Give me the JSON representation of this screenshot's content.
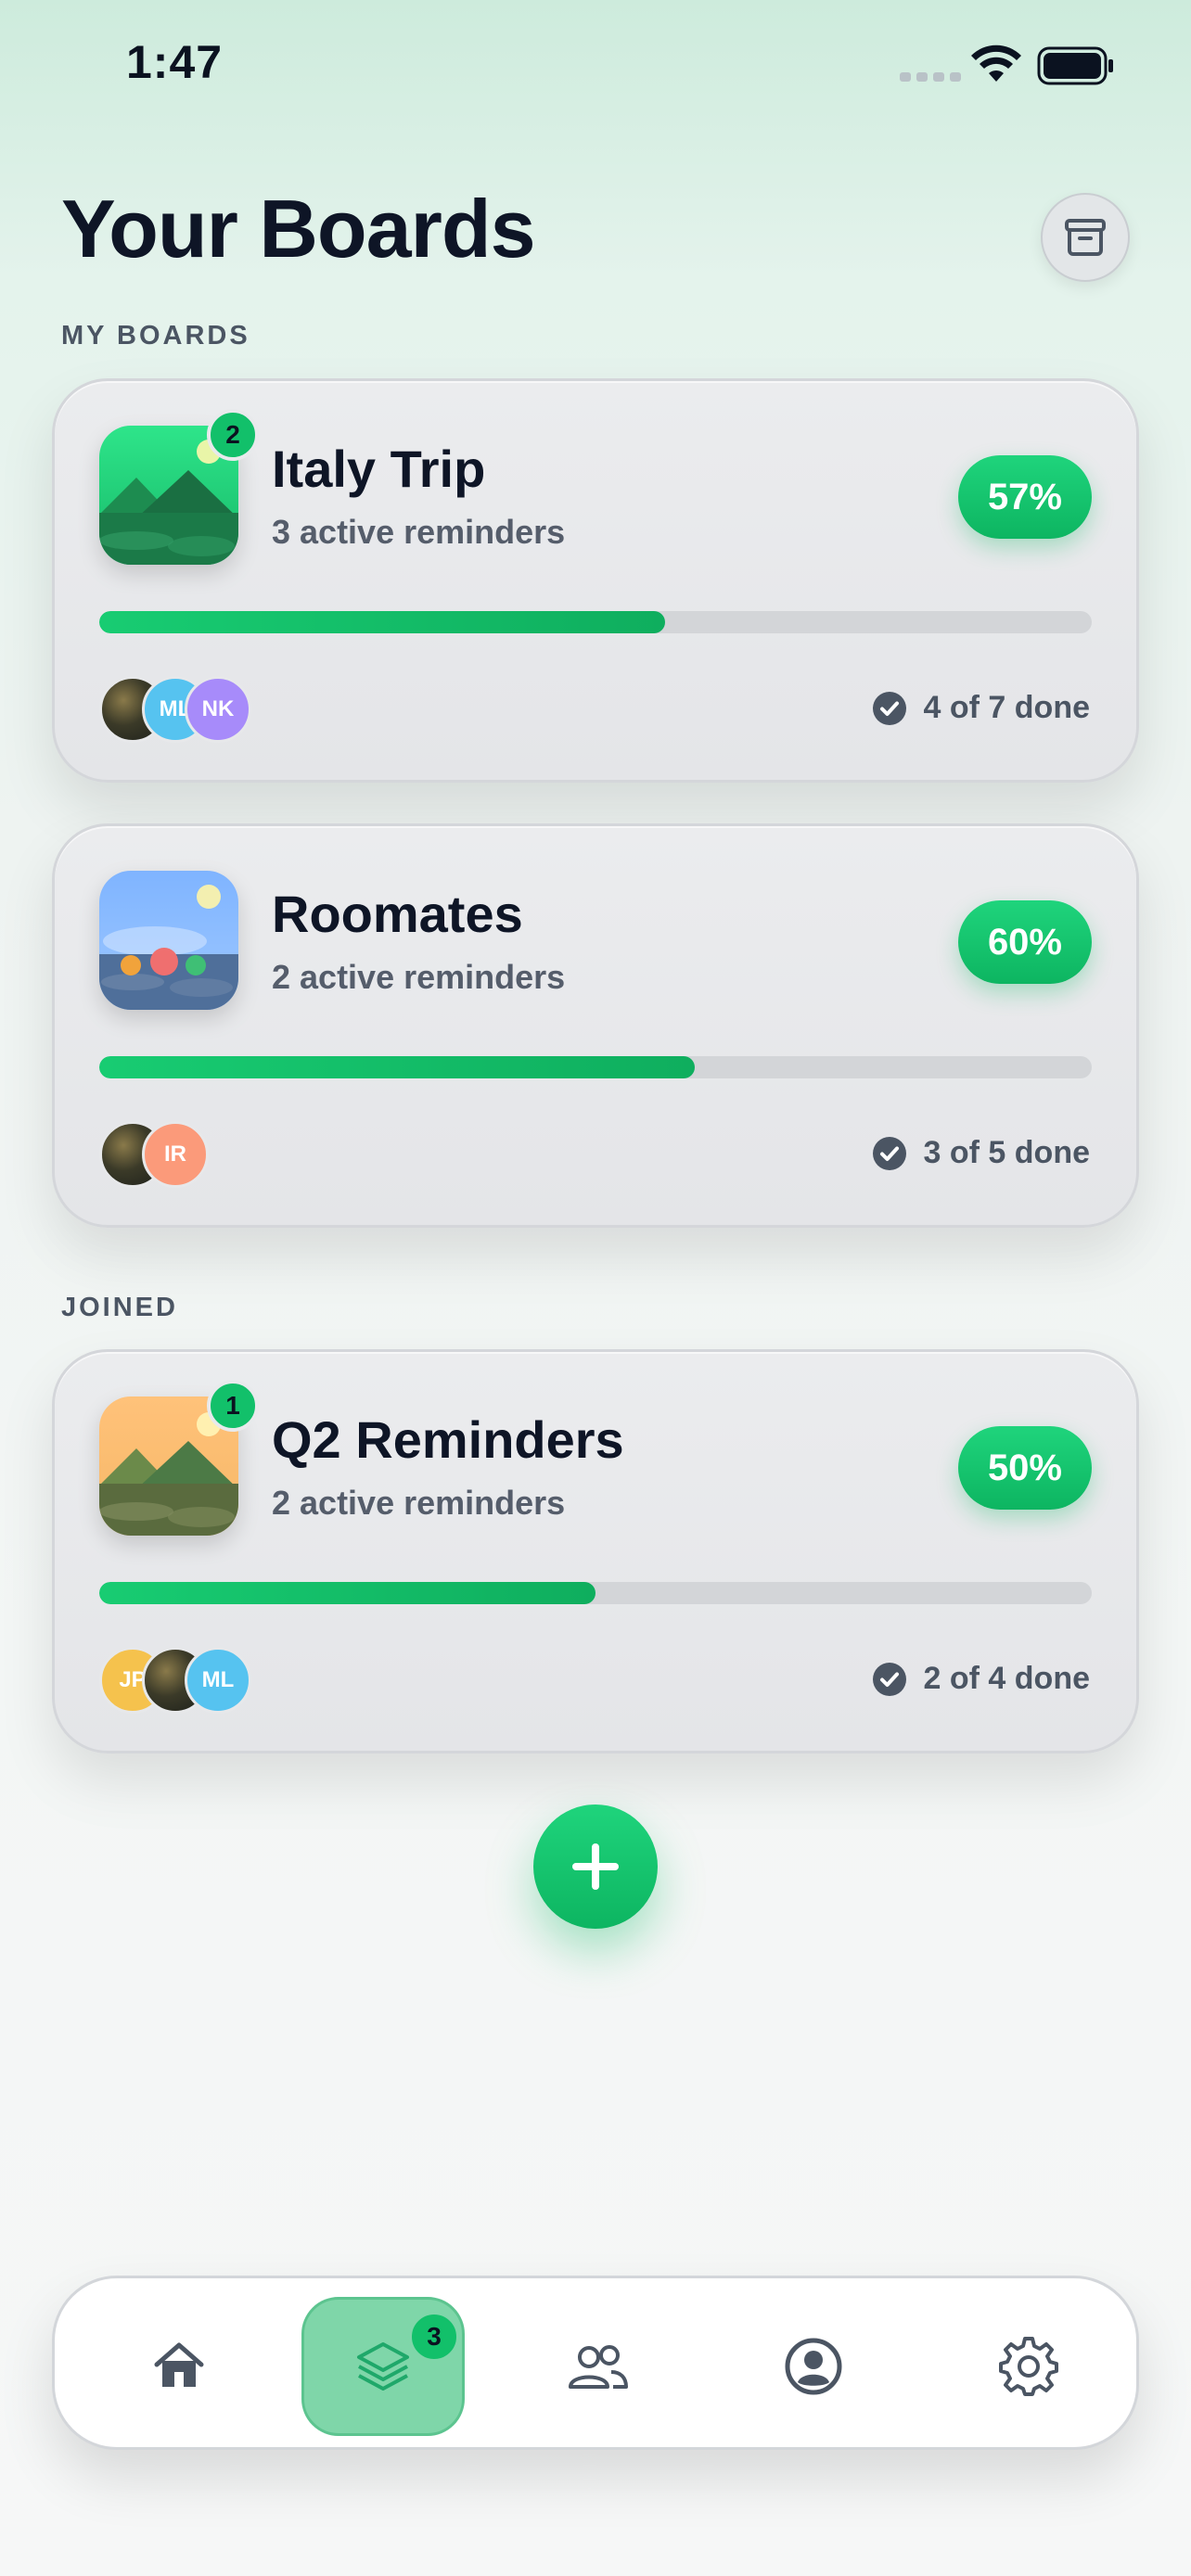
{
  "status_bar": {
    "time": "1:47"
  },
  "header": {
    "title": "Your Boards"
  },
  "sections": {
    "my_boards": "MY BOARDS",
    "joined": "JOINED"
  },
  "boards": [
    {
      "name": "Italy Trip",
      "subtitle": "3 active reminders",
      "percent_label": "57%",
      "progress": 0.57,
      "done_label": "4 of 7 done",
      "badge": "2",
      "avatars": [
        {
          "initials": "",
          "color": "#3a3a2a",
          "photo": true
        },
        {
          "initials": "ML",
          "color": "#56c3f0"
        },
        {
          "initials": "NK",
          "color": "#a78bfa"
        }
      ]
    },
    {
      "name": "Roomates",
      "subtitle": "2 active reminders",
      "percent_label": "60%",
      "progress": 0.6,
      "done_label": "3 of 5 done",
      "badge": "",
      "avatars": [
        {
          "initials": "",
          "color": "#3a3a2a",
          "photo": true
        },
        {
          "initials": "IR",
          "color": "#fb9a7a"
        }
      ]
    },
    {
      "name": "Q2 Reminders",
      "subtitle": "2 active reminders",
      "percent_label": "50%",
      "progress": 0.5,
      "done_label": "2 of 4 done",
      "badge": "1",
      "avatars": [
        {
          "initials": "JP",
          "color": "#f5c24d"
        },
        {
          "initials": "",
          "color": "#3a3a2a",
          "photo": true
        },
        {
          "initials": "ML",
          "color": "#56c3f0"
        }
      ]
    }
  ],
  "tab_bar": {
    "active": "boards",
    "boards_badge": "3",
    "tabs": [
      "home-icon",
      "boards-icon",
      "people-icon",
      "profile-icon",
      "settings-icon"
    ]
  },
  "colors": {
    "accent": "#10c16b",
    "accent_dark": "#0db561",
    "text": "#0e1526",
    "muted": "#555d6b"
  }
}
